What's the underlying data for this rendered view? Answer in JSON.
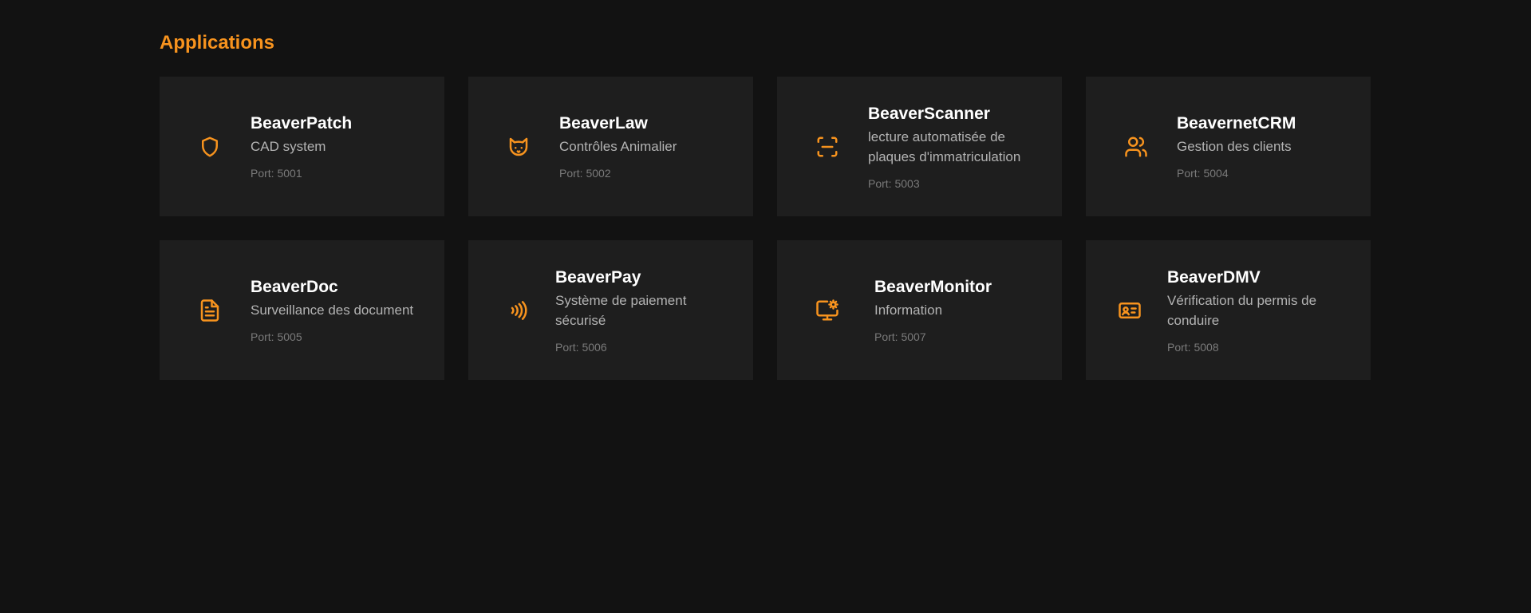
{
  "page": {
    "title": "Applications",
    "accent_color": "#f7931e"
  },
  "apps": [
    {
      "name": "BeaverPatch",
      "description": "CAD system",
      "port": "Port: 5001",
      "icon": "shield-icon"
    },
    {
      "name": "BeaverLaw",
      "description": "Contrôles Animalier",
      "port": "Port: 5002",
      "icon": "cat-icon"
    },
    {
      "name": "BeaverScanner",
      "description": "lecture automatisée de plaques d'immatriculation",
      "port": "Port: 5003",
      "icon": "scan-line-icon"
    },
    {
      "name": "BeavernetCRM",
      "description": "Gestion des clients",
      "port": "Port: 5004",
      "icon": "users-icon"
    },
    {
      "name": "BeaverDoc",
      "description": "Surveillance des document",
      "port": "Port: 5005",
      "icon": "file-text-icon"
    },
    {
      "name": "BeaverPay",
      "description": "Système de paiement sécurisé",
      "port": "Port: 5006",
      "icon": "contactless-icon"
    },
    {
      "name": "BeaverMonitor",
      "description": "Information",
      "port": "Port: 5007",
      "icon": "monitor-cog-icon"
    },
    {
      "name": "BeaverDMV",
      "description": "Vérification du permis de conduire",
      "port": "Port: 5008",
      "icon": "id-card-icon"
    }
  ]
}
